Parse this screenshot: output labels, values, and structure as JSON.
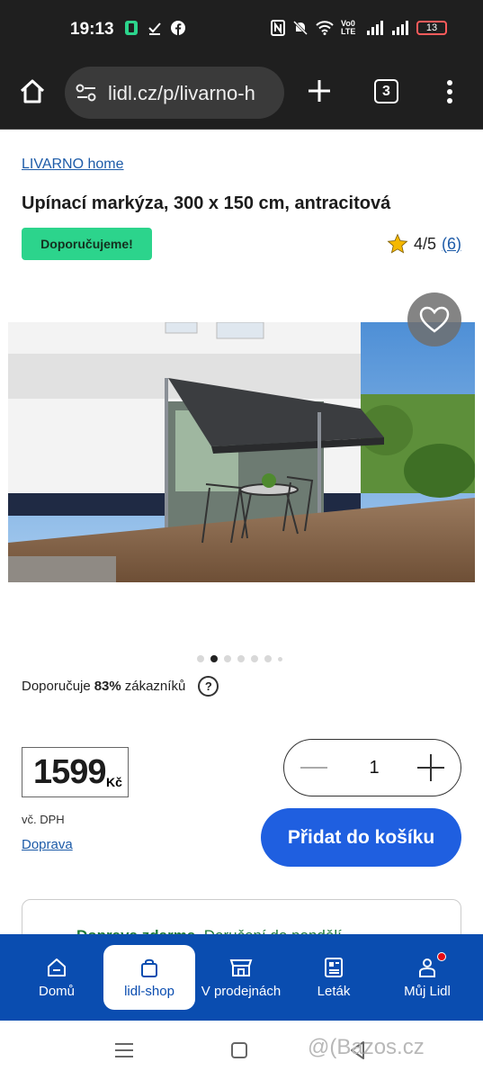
{
  "status_bar": {
    "time": "19:13",
    "network_label": "Vo0 LTE",
    "battery": "13"
  },
  "browser": {
    "url": "lidl.cz/p/livarno-h",
    "tab_count": "3"
  },
  "product": {
    "brand": "LIVARNO home",
    "title": "Upínací markýza, 300 x 150 cm, antracitová",
    "badge": "Doporučujeme!",
    "rating": "4/5",
    "rating_count": "(6)",
    "image_count": 7,
    "active_image_index": 1
  },
  "recommendation": {
    "prefix": "Doporučuje",
    "percent": "83%",
    "suffix": "zákazníků",
    "help": "?"
  },
  "price": {
    "value": "1599",
    "currency": "Kč",
    "vat_note": "vč. DPH",
    "shipping_link": "Doprava"
  },
  "quantity": {
    "value": "1"
  },
  "cart": {
    "add_label": "Přidat do košíku"
  },
  "delivery": {
    "free_label": "Doprava zdarma.",
    "date_label": "Doručení do pondělí"
  },
  "bottom_nav": {
    "items": [
      {
        "label": "Domů",
        "icon": "home-icon"
      },
      {
        "label": "lidl-shop",
        "icon": "shopping-bag-icon"
      },
      {
        "label": "V prodejnách",
        "icon": "store-icon"
      },
      {
        "label": "Leták",
        "icon": "leaflet-icon"
      },
      {
        "label": "Můj Lidl",
        "icon": "user-icon"
      }
    ],
    "active": "lidl-shop"
  },
  "watermark": "@(Bazos.cz",
  "colors": {
    "accent_blue": "#0a4db0",
    "button_blue": "#1f5fe0",
    "badge_green": "#2cd48c",
    "link_blue": "#1d5ba8"
  }
}
